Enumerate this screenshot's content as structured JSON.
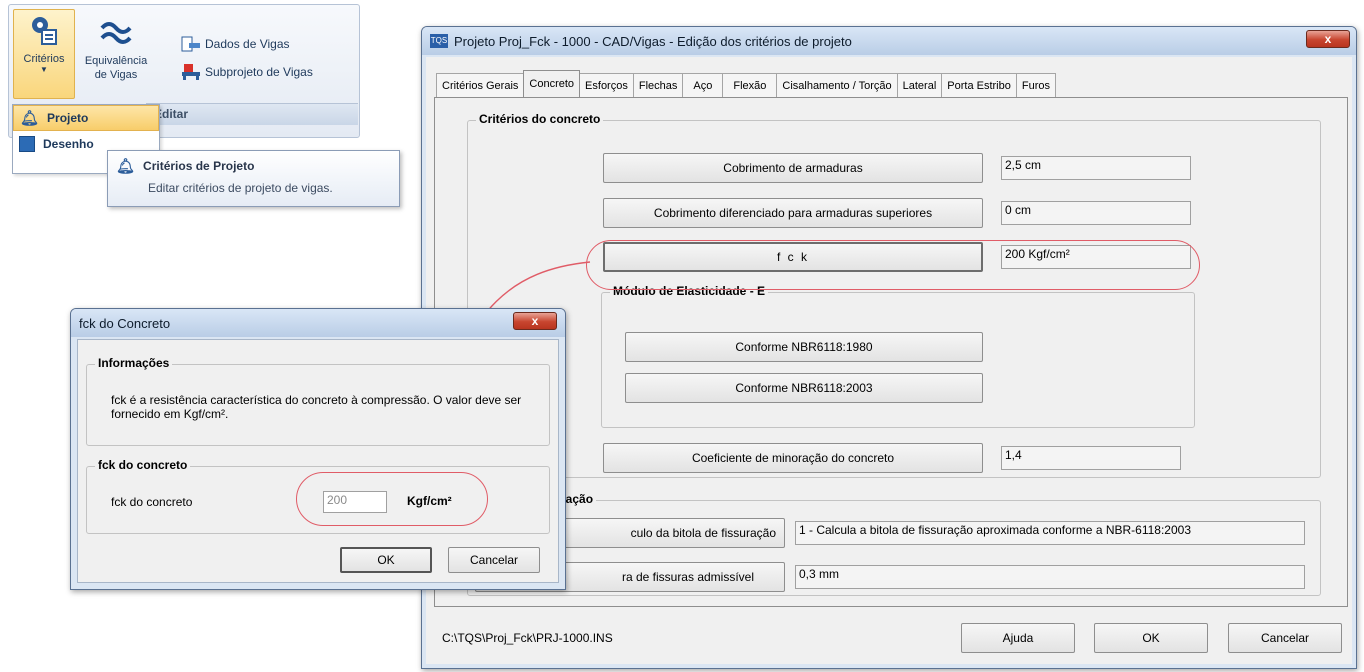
{
  "ribbon": {
    "criterios_label": "Critérios",
    "equivalencia_label": "Equivalência\nde Vigas",
    "dados_label": "Dados de Vigas",
    "subprojeto_label": "Subprojeto de Vigas",
    "group_label": "Editar",
    "menu_items": [
      "Projeto",
      "Desenho"
    ],
    "tooltip_title": "Critérios de Projeto",
    "tooltip_desc": "Editar critérios de projeto de vigas."
  },
  "main_window": {
    "title": "Projeto Proj_Fck - 1000 - CAD/Vigas - Edição dos critérios de projeto",
    "close_label": "x",
    "tabs": [
      "Critérios Gerais",
      "Concreto",
      "Esforços",
      "Flechas",
      "Aço",
      "Flexão",
      "Cisalhamento / Torção",
      "Lateral",
      "Porta Estribo",
      "Furos"
    ],
    "selected_tab": 1,
    "group_concreto": "Critérios do concreto",
    "cobrimento_btn": "Cobrimento de armaduras",
    "cobrimento_val": "2,5 cm",
    "cob_dif_btn": "Cobrimento diferenciado para armaduras superiores",
    "cob_dif_val": "0 cm",
    "fck_btn": "f c k",
    "fck_val": "200 Kgf/cm²",
    "group_modulo": "Módulo de Elasticidade - E",
    "nbr1980_btn": "Conforme NBR6118:1980",
    "nbr2003_btn": "Conforme NBR6118:2003",
    "coef_btn": "Coeficiente de minoração do concreto",
    "coef_val": "1,4",
    "group_bitola": "Bitola de fissuração",
    "calc_bitola_btn": "culo da bitola de fissuração",
    "calc_bitola_val": "1 - Calcula a bitola de fissuração aproximada conforme a NBR-6118:2003",
    "abertura_btn": "ra de fissuras admissível",
    "abertura_val": "0,3 mm",
    "path": "C:\\TQS\\Proj_Fck\\PRJ-1000.INS",
    "ajuda_btn": "Ajuda",
    "ok_btn": "OK",
    "cancelar_btn": "Cancelar"
  },
  "fck_dialog": {
    "title": "fck do Concreto",
    "close_label": "x",
    "group_info": "Informações",
    "info_text": "fck é a resistência característica do concreto à compressão. O valor deve ser fornecido em Kgf/cm².",
    "group_fck": "fck do concreto",
    "fck_label": "fck do concreto",
    "fck_value": "200",
    "unit": "Kgf/cm²",
    "ok_btn": "OK",
    "cancelar_btn": "Cancelar"
  },
  "colors": {
    "highlight": "#e05c67",
    "accent": "#1e395b"
  }
}
